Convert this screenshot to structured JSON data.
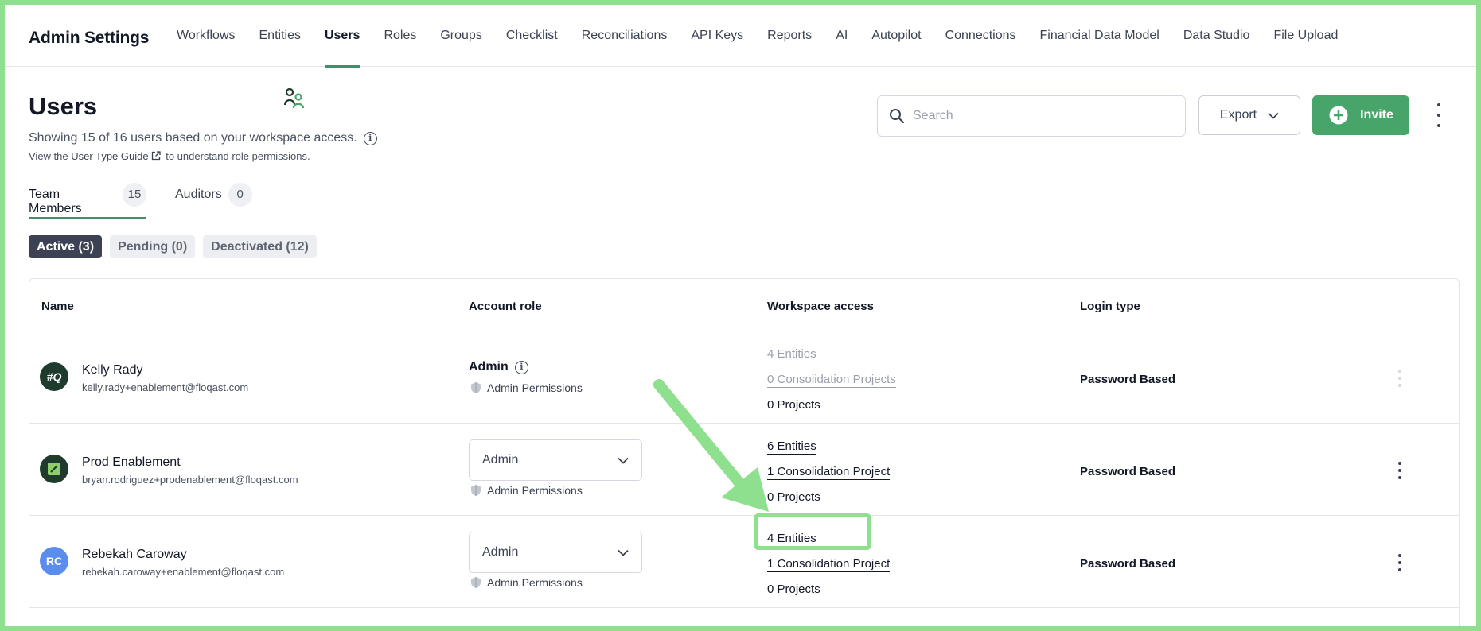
{
  "nav": {
    "brand": "Admin Settings",
    "tabs": [
      "Workflows",
      "Entities",
      "Users",
      "Roles",
      "Groups",
      "Checklist",
      "Reconciliations",
      "API Keys",
      "Reports",
      "AI",
      "Autopilot",
      "Connections",
      "Financial Data Model",
      "Data Studio",
      "File Upload"
    ],
    "active_tab": "Users"
  },
  "header": {
    "title": "Users",
    "summary": "Showing 15 of 16 users based on your workspace access.",
    "guide_prefix": "View the",
    "guide_link": "User Type Guide",
    "guide_suffix": "to understand role permissions."
  },
  "search": {
    "placeholder": "Search",
    "value": ""
  },
  "actions": {
    "export_label": "Export",
    "invite_label": "Invite"
  },
  "tabs": [
    {
      "label": "Team Members",
      "count": "15"
    },
    {
      "label": "Auditors",
      "count": "0"
    }
  ],
  "filters": [
    "Active (3)",
    "Pending (0)",
    "Deactivated (12)"
  ],
  "table": {
    "headers": [
      "Name",
      "Account role",
      "Workspace access",
      "Login type"
    ],
    "permission_label": "Admin Permissions",
    "rows": [
      {
        "avatar": "#Q",
        "name": "Kelly Rady",
        "email": "kelly.rady+enablement@floqast.com",
        "role": "Admin",
        "entities": "4 Entities",
        "consolidation": "0 Consolidation Projects",
        "projects": "0 Projects",
        "login": "Password Based"
      },
      {
        "avatar": "",
        "name": "Prod Enablement",
        "email": "bryan.rodriguez+prodenablement@floqast.com",
        "role": "Admin",
        "entities": "6 Entities",
        "consolidation": "1 Consolidation Project",
        "projects": "0 Projects",
        "login": "Password Based"
      },
      {
        "avatar": "RC",
        "name": "Rebekah Caroway",
        "email": "rebekah.caroway+enablement@floqast.com",
        "role": "Admin",
        "entities": "4 Entities",
        "consolidation": "1 Consolidation Project",
        "projects": "0 Projects",
        "login": "Password Based"
      }
    ]
  },
  "colors": {
    "accent": "#47a569",
    "annotation": "#8ee08f",
    "active_chip": "#3c4154",
    "avatar_rc": "#5b8def",
    "avatar_kr": "#1f3b2e"
  }
}
